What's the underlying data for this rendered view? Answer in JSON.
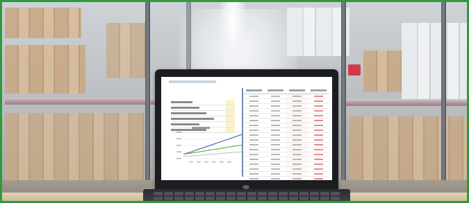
{
  "scene": {
    "description_tag": "laptop-on-desk-warehouse-background",
    "accent_colors": {
      "frame_border": "#2e9a3c",
      "chart_line_primary": "#3a68a8",
      "chart_line_secondary": "#5aa83a",
      "table_accent": "#6d8fb4",
      "warning_sign": "#d3394b"
    }
  },
  "spreadsheet": {
    "summary_rows": 6,
    "table_columns": 4,
    "table_rows": 18
  },
  "chart_data": {
    "type": "line",
    "x": [
      0,
      1,
      2,
      3,
      4,
      5,
      6,
      7,
      8
    ],
    "series": [
      {
        "values": [
          2,
          3,
          4.2,
          5.3,
          6.4,
          7.6,
          8.7,
          9.9,
          11
        ]
      },
      {
        "values": [
          2,
          2.5,
          3,
          3.6,
          4.1,
          4.6,
          5.2,
          5.7,
          6.2
        ]
      },
      {
        "values": [
          1,
          1.2,
          1.5,
          1.8,
          2,
          2.3,
          2.6,
          2.9,
          3.2
        ]
      }
    ]
  }
}
